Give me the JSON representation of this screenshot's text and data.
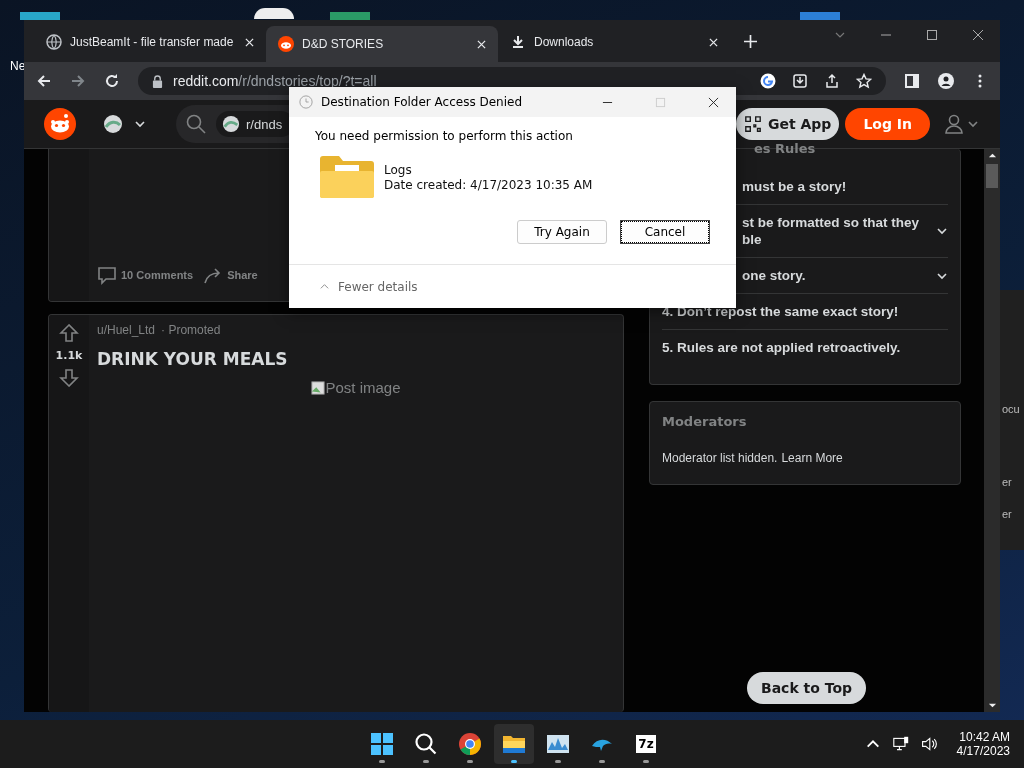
{
  "desktop": {
    "label": "Ne"
  },
  "background_window": {
    "texts": [
      "ocu",
      "er",
      "er"
    ]
  },
  "browser": {
    "tabs": [
      {
        "title": "JustBeamIt - file transfer made",
        "selected": false,
        "kind": "globe"
      },
      {
        "title": "D&D STORIES",
        "selected": true,
        "kind": "reddit"
      },
      {
        "title": "Downloads",
        "selected": false,
        "kind": "download"
      }
    ],
    "url": {
      "host": "reddit.com",
      "path": "/r/dndstories/top/?t=all"
    }
  },
  "reddit": {
    "search": "r/dnds",
    "get_app": "Get App",
    "log_in": "Log In",
    "posts": [
      {
        "kind": "footer",
        "comments": "10 Comments",
        "share": "Share"
      },
      {
        "kind": "promoted",
        "score": "1.1k",
        "author": "u/Huel_Ltd",
        "tag": "· Promoted",
        "title": "DRINK YOUR MEALS",
        "image_alt": "Post image"
      }
    ],
    "rules": {
      "title": "es Rules",
      "items": [
        {
          "text": "must be a story!",
          "kind": "partial",
          "expandable": false
        },
        {
          "text": "st be formatted so that they\nble",
          "kind": "partial",
          "expandable": true
        },
        {
          "text": "one story.",
          "kind": "partial",
          "expandable": true
        },
        {
          "text": "4. Don’t repost the same exact story!",
          "kind": "full",
          "expandable": false
        },
        {
          "text": "5. Rules are not applied retroactively.",
          "kind": "full",
          "expandable": false
        }
      ]
    },
    "moderators": {
      "title": "Moderators",
      "text": "Moderator list hidden.",
      "link": "Learn More"
    },
    "back_to_top": "Back to Top"
  },
  "dialog": {
    "title": "Destination Folder Access Denied",
    "message": "You need permission to perform this action",
    "file": "Logs",
    "date": "Date created: 4/17/2023 10:35 AM",
    "buttons": [
      {
        "label": "Try Again",
        "focused": false
      },
      {
        "label": "Cancel",
        "focused": true
      }
    ],
    "details": "Fewer details"
  },
  "taskbar": {
    "apps": [
      {
        "kind": "start",
        "selected": false
      },
      {
        "kind": "search",
        "selected": false
      },
      {
        "kind": "chrome",
        "selected": false
      },
      {
        "kind": "explorer",
        "selected": true
      },
      {
        "kind": "monitor",
        "selected": false
      },
      {
        "kind": "dolphin",
        "selected": false
      },
      {
        "kind": "archive",
        "selected": false,
        "label": "7z"
      }
    ],
    "time": "10:42 AM",
    "date": "4/17/2023"
  }
}
